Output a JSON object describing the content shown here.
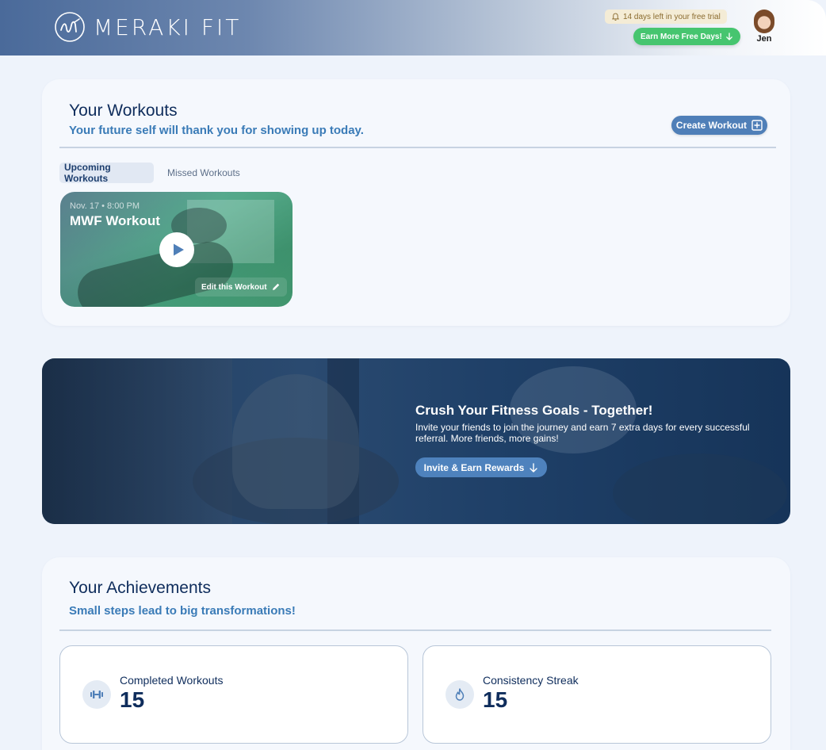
{
  "header": {
    "brand": "MERAKI FIT",
    "trial_text": "14 days left in your free trial",
    "earn_button": "Earn More Free Days!",
    "user_name": "Jen"
  },
  "workouts": {
    "title": "Your Workouts",
    "subtitle": "Your future self will thank you for showing up today.",
    "create_button": "Create Workout",
    "tabs": [
      {
        "label": "Upcoming Workouts",
        "active": true
      },
      {
        "label": "Missed Workouts",
        "active": false
      }
    ],
    "items": [
      {
        "date": "Nov. 17  •  8:00 PM",
        "title": "MWF Workout",
        "edit_label": "Edit this Workout"
      }
    ]
  },
  "banner": {
    "title": "Crush Your Fitness Goals - Together!",
    "text": "Invite your friends to join the journey and earn 7 extra days for every successful referral. More friends, more gains!",
    "button": "Invite & Earn Rewards"
  },
  "achievements": {
    "title": "Your Achievements",
    "subtitle": "Small steps lead to big transformations!",
    "stats": [
      {
        "label": "Completed Workouts",
        "value": "15",
        "icon": "dumbbell-icon"
      },
      {
        "label": "Consistency Streak",
        "value": "15",
        "icon": "flame-icon"
      }
    ]
  },
  "colors": {
    "primary": "#4f7fb8",
    "accent_green": "#46c56f",
    "title_navy": "#0f2d5c",
    "subtitle_blue": "#3a7bb7"
  }
}
